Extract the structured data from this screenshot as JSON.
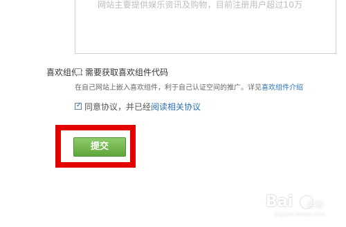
{
  "description_field": {
    "text": "网站主要提供娱乐资讯及购物，目前注册用户超过10万"
  },
  "widget": {
    "label": "喜欢组件：",
    "option_label": "需要获取喜欢组件代码",
    "option_checked": false,
    "hint_text": "在自己网站上嵌入喜欢组件，利于自己认证空间的推广。详见",
    "hint_link": "喜欢组件介绍"
  },
  "agreement": {
    "checked": true,
    "text": "同意协议，并已经",
    "link": "阅读相关协议"
  },
  "submit": {
    "label": "提交"
  },
  "watermark": {
    "brand": "Bai",
    "sub": "经验",
    "url": "jingyan.baidu.com"
  },
  "colors": {
    "accent_link": "#2a72b5",
    "submit_button": "#6fb648",
    "highlight_box": "#e30000"
  }
}
